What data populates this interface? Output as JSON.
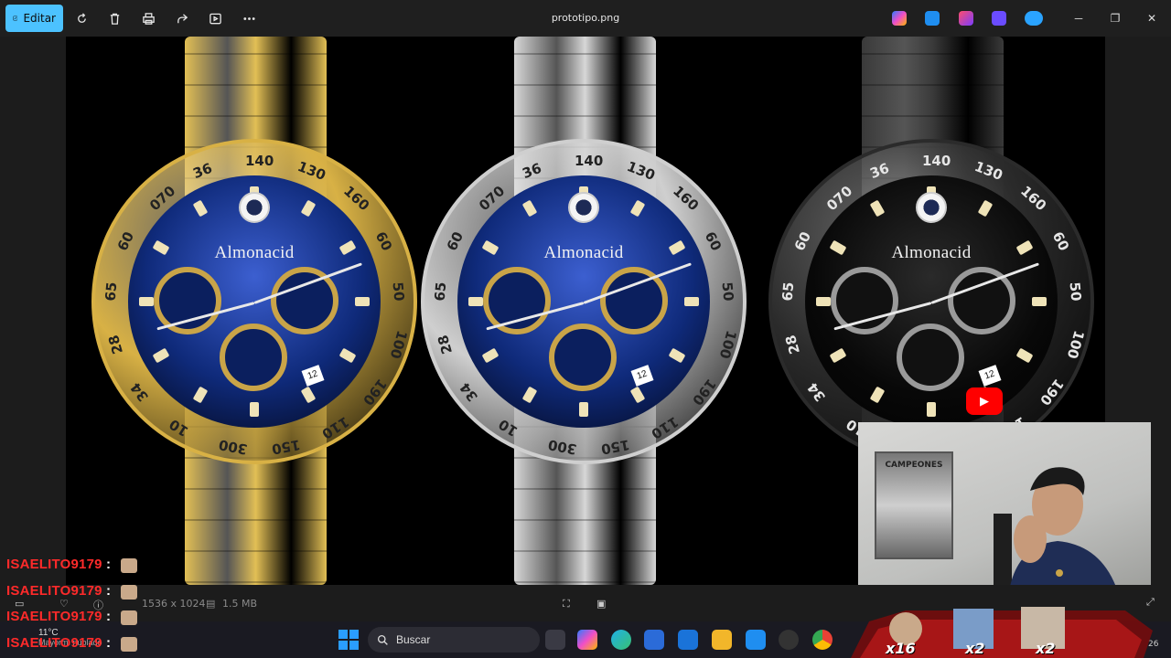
{
  "toolbar": {
    "edit_label": "Editar",
    "filename": "prototipo.png"
  },
  "image": {
    "watches": [
      {
        "brand": "Almonacid",
        "finish": "gold",
        "bezel": "#d8b145",
        "dial": "#0f2a7a",
        "strap": "#e2bf55"
      },
      {
        "brand": "Almonacid",
        "finish": "silver",
        "bezel": "#cfcfcf",
        "dial": "#0f2a7a",
        "strap": "#d7d7d7"
      },
      {
        "brand": "Almonacid",
        "finish": "black",
        "bezel": "#2b2b2b",
        "dial": "#0a0a0a",
        "strap": "#3a3a3a"
      }
    ],
    "bezel_numbers": [
      "140",
      "130",
      "160",
      "60",
      "50",
      "100",
      "190",
      "110",
      "150",
      "300",
      "10",
      "34",
      "28",
      "65",
      "60",
      "070",
      "36"
    ]
  },
  "webcam": {
    "poster_text": "CAMPEONES"
  },
  "info_bar": {
    "dimensions": "1536 x 1024",
    "size": "1.5 MB"
  },
  "taskbar": {
    "search_placeholder": "Buscar",
    "weather_temp": "11°C",
    "weather_desc": "Mayorm. nublado",
    "clock_fragment": "26"
  },
  "chat": {
    "lines": [
      {
        "user": "ISAELITO9179",
        "sep": ":"
      },
      {
        "user": "ISAELITO9179",
        "sep": ":"
      },
      {
        "user": "ISAELITO9179",
        "sep": ":"
      },
      {
        "user": "ISAELITO9179",
        "sep": ":"
      }
    ]
  },
  "donation": {
    "combos": [
      "x16",
      "x2",
      "x2"
    ]
  },
  "colors": {
    "accent": "#4cc2ff",
    "chat_user": "#ff2a2a",
    "youtube": "#ff0000"
  }
}
